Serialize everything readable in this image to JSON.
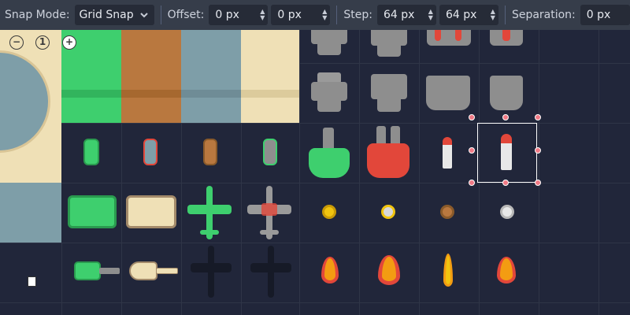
{
  "toolbar": {
    "snap_mode_label": "Snap Mode:",
    "snap_mode_value": "Grid Snap",
    "offset_label": "Offset:",
    "offset_x": "0 px",
    "offset_y": "0 px",
    "step_label": "Step:",
    "step_x": "64 px",
    "step_y": "64 px",
    "separation_label": "Separation:",
    "separation_x": "0 px"
  },
  "zoom": {
    "out_symbol": "−",
    "reset_symbol": "1",
    "in_symbol": "+"
  },
  "colors": {
    "toolbar_bg": "#363d4a",
    "canvas_bg": "#21263a",
    "grid_line": "#2f3547",
    "selection": "#ffffff",
    "handle": "#f07a86",
    "green": "#3ecf6e",
    "brown": "#b9783f",
    "slate": "#7e9ea8",
    "sand": "#efe0b6",
    "red": "#e2473a",
    "gray": "#8e8e8e"
  },
  "icons": [
    "chevron-down-icon",
    "spin-arrows-icon",
    "zoom-out-icon",
    "zoom-reset-icon",
    "zoom-in-icon"
  ]
}
